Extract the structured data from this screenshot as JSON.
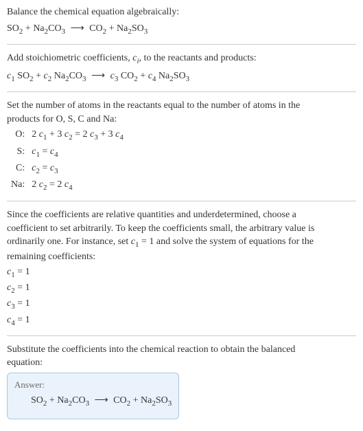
{
  "chart_data": {
    "type": "table",
    "title": "Balance chemical equation algebraically",
    "reaction": {
      "reactants": [
        "SO2",
        "Na2CO3"
      ],
      "products": [
        "CO2",
        "Na2SO3"
      ],
      "coefficients": {
        "c1": 1,
        "c2": 1,
        "c3": 1,
        "c4": 1
      }
    },
    "atom_balance": [
      {
        "element": "O",
        "equation": "2 c1 + 3 c2 = 2 c3 + 3 c4"
      },
      {
        "element": "S",
        "equation": "c1 = c4"
      },
      {
        "element": "C",
        "equation": "c2 = c3"
      },
      {
        "element": "Na",
        "equation": "2 c2 = 2 c4"
      }
    ]
  },
  "intro": {
    "line1": "Balance the chemical equation algebraically:",
    "eq_so2": "SO",
    "eq_na2co3_na2": "Na",
    "eq_na2co3_co3": "CO",
    "eq_co2": "CO",
    "eq_na2so3_na2": "Na",
    "eq_na2so3_so3": "SO",
    "plus": " + ",
    "arrow": "⟶"
  },
  "stoich": {
    "text_a": "Add stoichiometric coefficients, ",
    "ci": "c",
    "ci_sub": "i",
    "text_b": ", to the reactants and products:",
    "c1": "c",
    "c2": "c",
    "c3": "c",
    "c4": "c",
    "s1": "1",
    "s2": "2",
    "s3": "3",
    "s4": "4",
    "so2": "SO",
    "na": "Na",
    "co": "CO",
    "so": "SO"
  },
  "atoms": {
    "intro_a": "Set the number of atoms in the reactants equal to the number of atoms in the",
    "intro_b": "products for O, S, C and Na:",
    "rows": [
      {
        "label": "O:",
        "eq_a": "2 ",
        "eq_b": " + 3 ",
        "eq_c": " = 2 ",
        "eq_d": " + 3 "
      },
      {
        "label": "S:",
        "eq_mid": " = "
      },
      {
        "label": "C:",
        "eq_mid": " = "
      },
      {
        "label": "Na:",
        "eq_a": "2 ",
        "eq_b": " = 2 "
      }
    ]
  },
  "solve": {
    "p1": "Since the coefficients are relative quantities and underdetermined, choose a",
    "p2": "coefficient to set arbitrarily. To keep the coefficients small, the arbitrary value is",
    "p3a": "ordinarily one. For instance, set ",
    "p3b": " = 1 and solve the system of equations for the",
    "p4": "remaining coefficients:",
    "r1": " = 1",
    "r2": " = 1",
    "r3": " = 1",
    "r4": " = 1"
  },
  "subst": {
    "p1": "Substitute the coefficients into the chemical reaction to obtain the balanced",
    "p2": "equation:"
  },
  "answer": {
    "label": "Answer:"
  },
  "sub2": "2",
  "sub3": "3"
}
